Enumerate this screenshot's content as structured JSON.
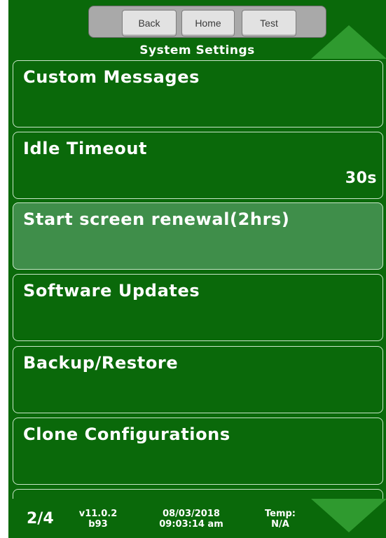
{
  "nav": {
    "back_label": "Back",
    "home_label": "Home",
    "test_label": "Test"
  },
  "header": {
    "title": "System Settings"
  },
  "menu": {
    "items": [
      {
        "label": "Custom Messages",
        "value": ""
      },
      {
        "label": "Idle Timeout",
        "value": "30s"
      },
      {
        "label": "Start screen renewal(2hrs)",
        "value": "",
        "selected": true
      },
      {
        "label": "Software Updates",
        "value": ""
      },
      {
        "label": "Backup/Restore",
        "value": ""
      },
      {
        "label": "Clone Configurations",
        "value": ""
      },
      {
        "label": "",
        "value": ""
      }
    ]
  },
  "status": {
    "page": "2/4",
    "version_line1": "v11.0.2",
    "version_line2": "b93",
    "date": "08/03/2018",
    "time": "09:03:14 am",
    "temp_label": "Temp:",
    "temp_value": "N/A"
  },
  "colors": {
    "background": "#0a690a",
    "arrow": "#2f9a2f",
    "selected_item": "#3f8e4a"
  },
  "icons": {
    "scroll_up": "triangle-up-icon",
    "scroll_down": "triangle-down-icon"
  }
}
